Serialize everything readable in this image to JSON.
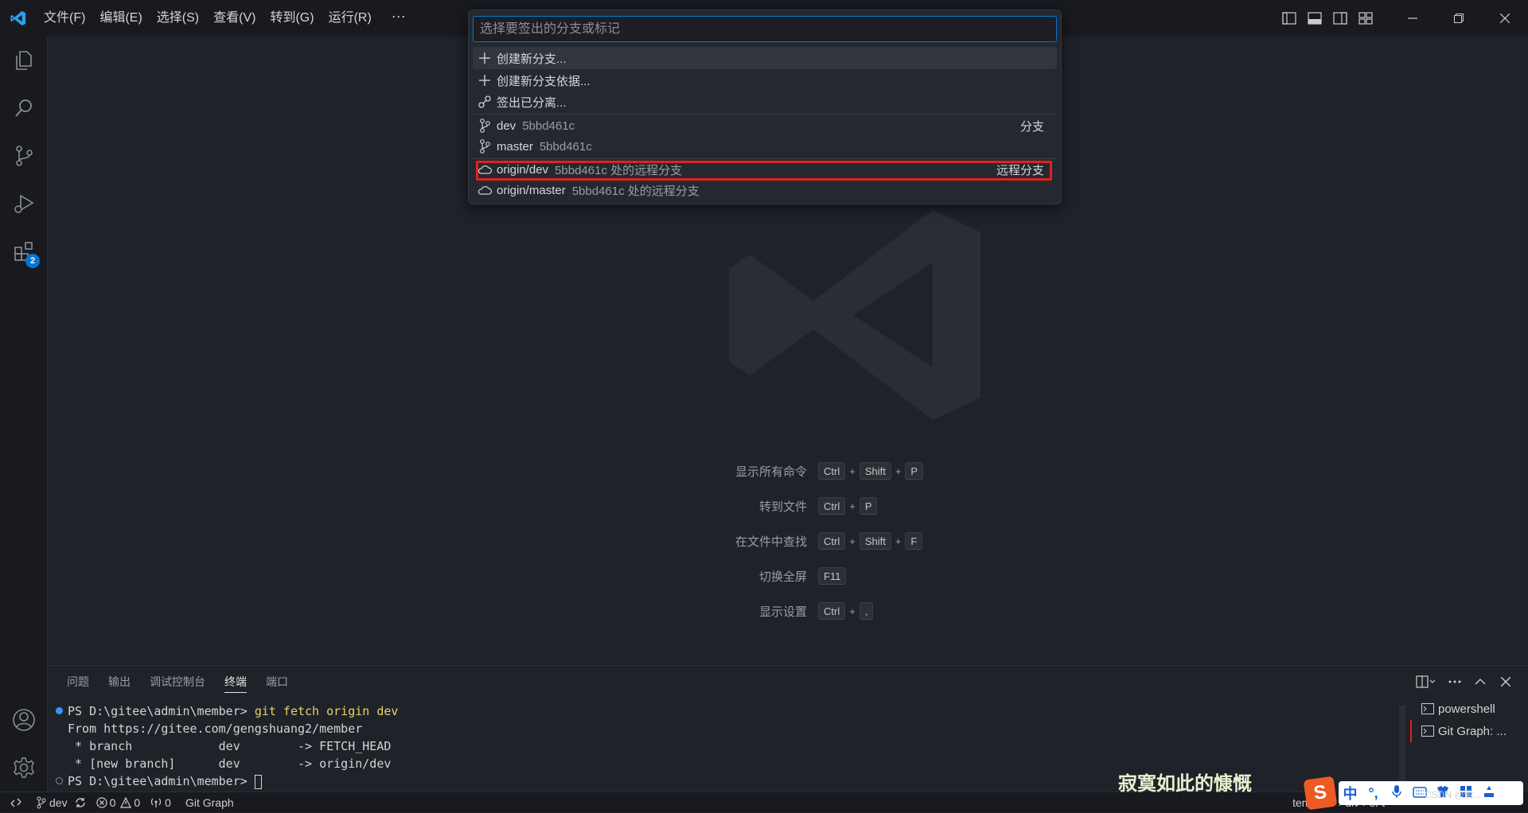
{
  "menu": [
    "文件(F)",
    "编辑(E)",
    "选择(S)",
    "查看(V)",
    "转到(G)",
    "运行(R)"
  ],
  "menu_more": "···",
  "activity_badge": "2",
  "quickpick": {
    "placeholder": "选择要签出的分支或标记",
    "actions": [
      {
        "label": "创建新分支...",
        "icon": "plus-icon"
      },
      {
        "label": "创建新分支依据...",
        "icon": "plus-icon"
      },
      {
        "label": "签出已分离...",
        "icon": "detached-icon"
      }
    ],
    "branches": [
      {
        "name": "dev",
        "commit": "5bbd461c",
        "tag": "分支"
      },
      {
        "name": "master",
        "commit": "5bbd461c",
        "tag": ""
      }
    ],
    "remotes": [
      {
        "name": "origin/dev",
        "commit": "5bbd461c 处的远程分支",
        "tag": "远程分支"
      },
      {
        "name": "origin/master",
        "commit": "5bbd461c 处的远程分支",
        "tag": ""
      }
    ]
  },
  "shortcuts": [
    {
      "label": "显示所有命令",
      "keys": [
        "Ctrl",
        "Shift",
        "P"
      ]
    },
    {
      "label": "转到文件",
      "keys": [
        "Ctrl",
        "P"
      ]
    },
    {
      "label": "在文件中查找",
      "keys": [
        "Ctrl",
        "Shift",
        "F"
      ]
    },
    {
      "label": "切换全屏",
      "keys": [
        "F11"
      ]
    },
    {
      "label": "显示设置",
      "keys": [
        "Ctrl",
        ","
      ]
    }
  ],
  "panel": {
    "tabs": [
      "问题",
      "输出",
      "调试控制台",
      "终端",
      "端口"
    ],
    "active_tab": "终端",
    "terminal": {
      "prompt1": "PS D:\\gitee\\admin\\member> ",
      "cmd1": "git fetch origin dev",
      "line2": "From https://gitee.com/gengshuang2/member",
      "line3": " * branch            dev        -> FETCH_HEAD",
      "line4": " * [new branch]      dev        -> origin/dev",
      "prompt2": "PS D:\\gitee\\admin\\member> "
    },
    "terminals": [
      "powershell",
      "Git Graph: ..."
    ]
  },
  "status": {
    "branch": "dev",
    "errors": "0",
    "warnings": "0",
    "ports": "0",
    "git_graph": "Git Graph",
    "breadcrumb": "template › div › el-t"
  },
  "overlay_text": "寂寞如此的慷慨",
  "ime": {
    "logo": "S",
    "lang": "中"
  },
  "csdn_watermark": "CSDN @紫..."
}
